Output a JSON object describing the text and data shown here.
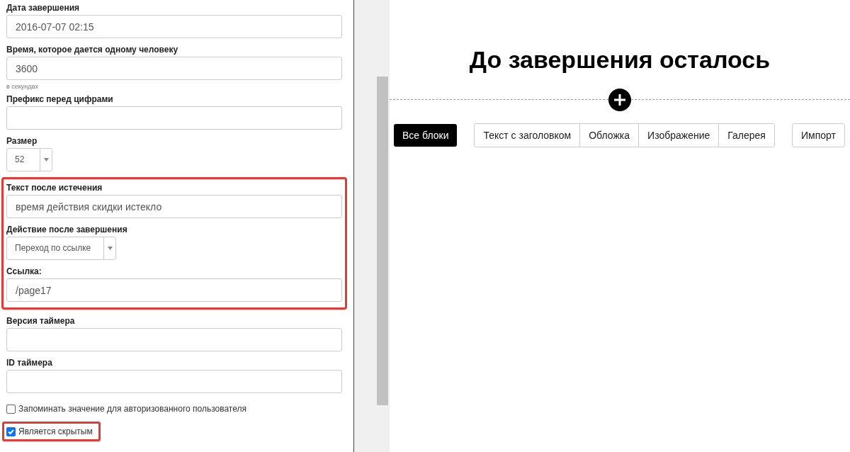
{
  "form": [
    {
      "kind": "text",
      "label": "Дата завершения",
      "value": "2016-07-07 02:15"
    },
    {
      "kind": "text",
      "label": "Время, которое дается одному человеку",
      "value": "3600",
      "hint": "в секундах"
    },
    {
      "kind": "text",
      "label": "Префикс перед цифрами"
    },
    {
      "kind": "select",
      "label": "Размер",
      "value": "52"
    },
    {
      "kind": "group",
      "highlighted": true,
      "fields": [
        {
          "kind": "text",
          "label": "Текст после истечения",
          "value": "время действия скидки истекло"
        },
        {
          "kind": "select",
          "label": "Действие после завершения",
          "value": "Переход по ссылке"
        },
        {
          "kind": "text",
          "label": "Ссылка:",
          "value": "/page17"
        }
      ]
    },
    {
      "kind": "text",
      "label": "Версия таймера"
    },
    {
      "kind": "text",
      "label": "ID таймера"
    },
    {
      "kind": "checkbox",
      "label": "Запоминать значение для авторизованного пользователя",
      "checked": false,
      "highlighted": false
    },
    {
      "kind": "checkbox",
      "label": "Является скрытым",
      "checked": true,
      "highlighted": true
    }
  ],
  "preview": {
    "heading": "До завершения осталось"
  },
  "category_buttons": [
    {
      "label": "Все блоки",
      "selected": true
    }
  ],
  "block_types": [
    {
      "label": "Текст с заголовком",
      "selected": false
    },
    {
      "label": "Обложка",
      "selected": false
    },
    {
      "label": "Изображение",
      "selected": false
    },
    {
      "label": "Галерея",
      "selected": false
    }
  ],
  "import_button": "Импорт"
}
